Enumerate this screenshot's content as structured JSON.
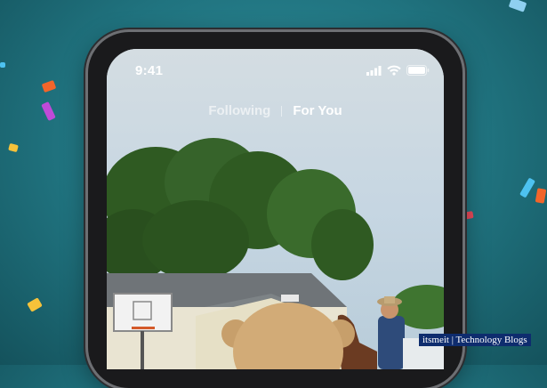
{
  "status_bar": {
    "time": "9:41"
  },
  "feed_tabs": {
    "following": "Following",
    "for_you": "For You"
  },
  "watermark": "itsmeit | Technology Blogs",
  "icons": [
    "signal-icon",
    "wifi-icon",
    "battery-icon"
  ],
  "colors": {
    "background": "#20737f",
    "phone_frame": "#1a1a1c",
    "watermark_bg": "#0e2c6e"
  }
}
